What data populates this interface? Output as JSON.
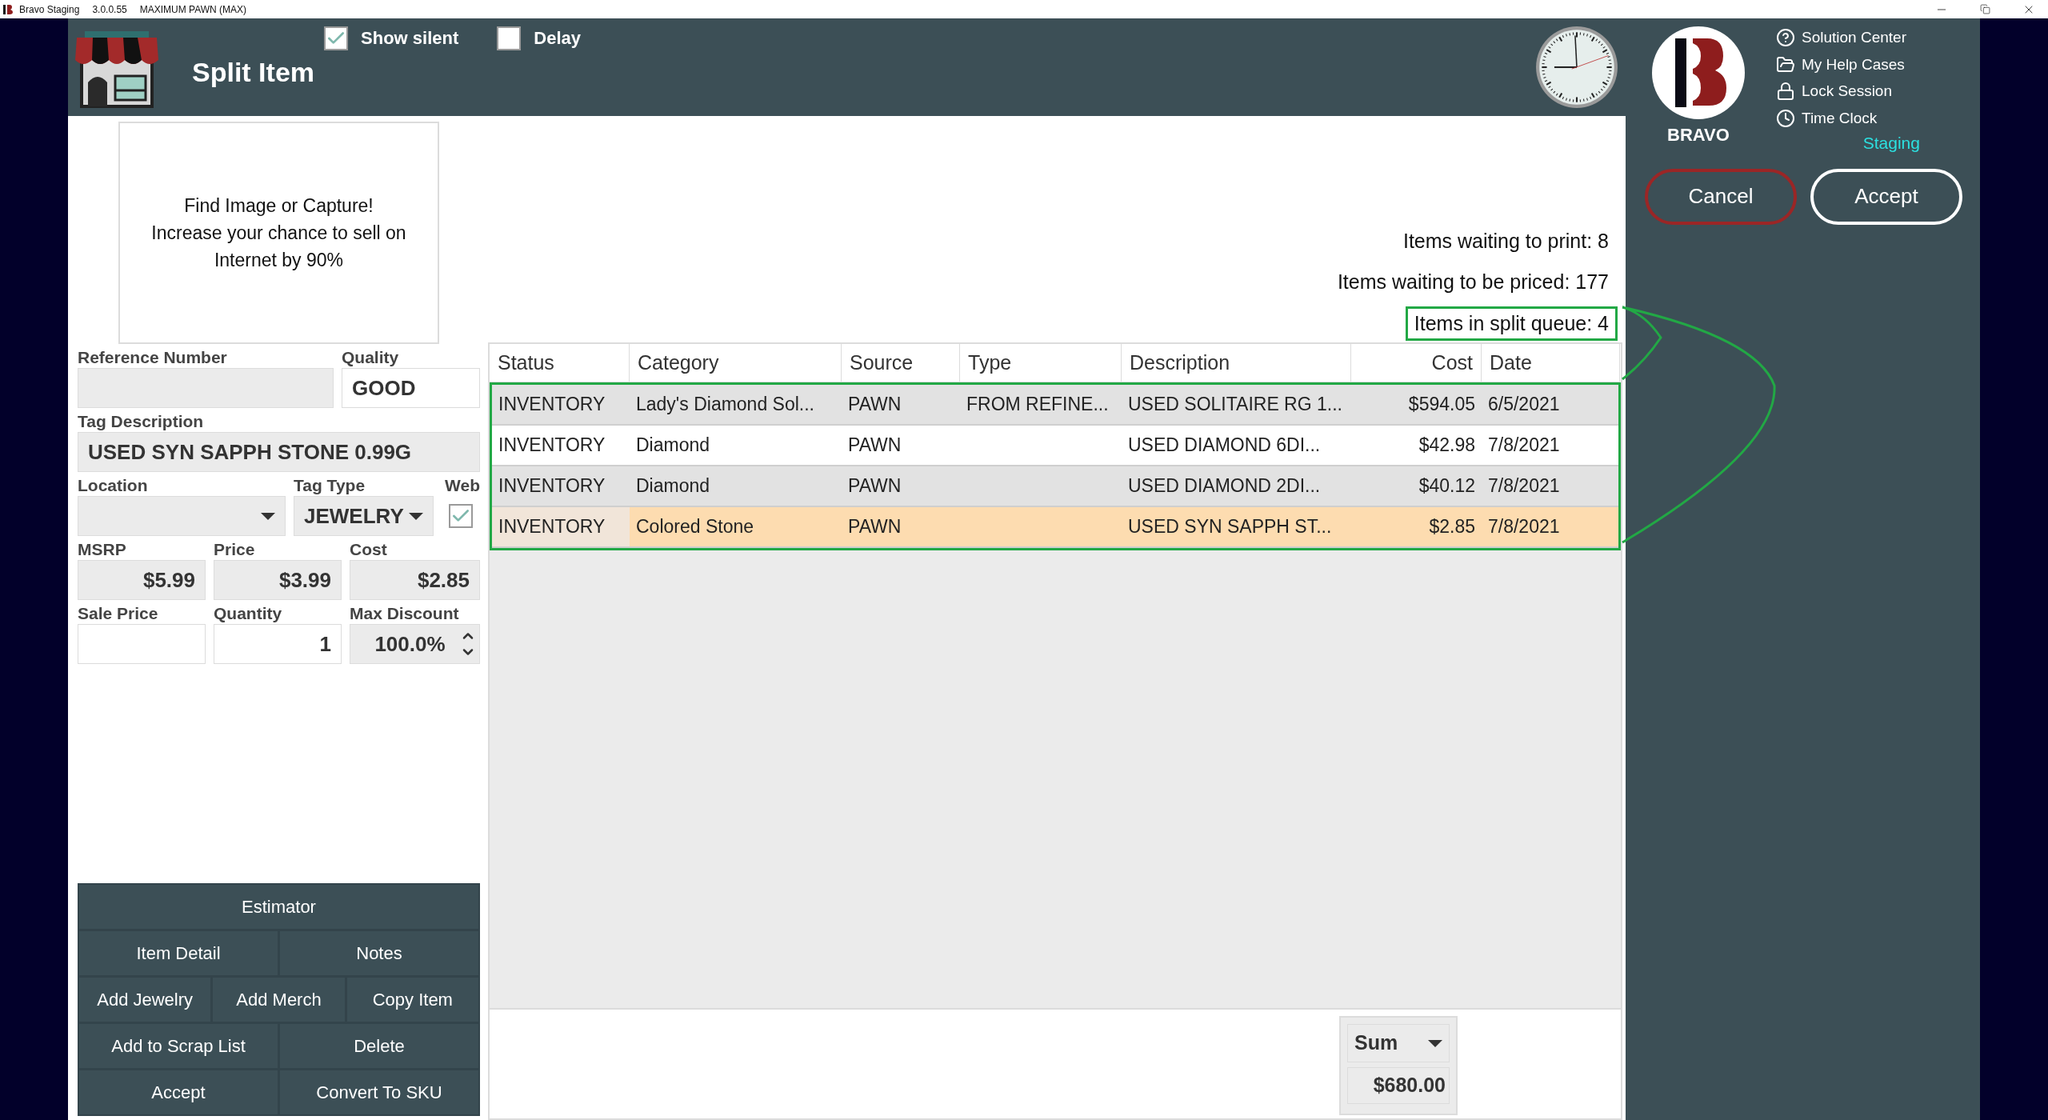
{
  "title_bar": {
    "app": "Bravo Staging",
    "version": "3.0.0.55",
    "company": "MAXIMUM PAWN (MAX)"
  },
  "header": {
    "title": "Split Item",
    "toggles": [
      {
        "label": "Show silent",
        "checked": true
      },
      {
        "label": "Delay",
        "checked": false
      }
    ]
  },
  "brand": {
    "logo_text": "BRAVO",
    "environment": "Staging"
  },
  "help_links": [
    {
      "label": "Solution Center",
      "kind": "help"
    },
    {
      "label": "My Help Cases",
      "kind": "folder"
    },
    {
      "label": "Lock Session",
      "kind": "lock"
    },
    {
      "label": "Time Clock",
      "kind": "clock"
    }
  ],
  "actions": [
    {
      "label": "Cancel",
      "kind": "cancel"
    },
    {
      "label": "Accept",
      "kind": "accept"
    }
  ],
  "form": {
    "image_prompt": [
      "Find Image or Capture!",
      "Increase your chance to sell on Internet by 90%"
    ],
    "rows": [
      [
        {
          "label": "Reference Number",
          "kind": "text",
          "readonly": true
        },
        {
          "label": "Quality",
          "kind": "text",
          "value": "GOOD",
          "readonly": false
        }
      ],
      [
        {
          "label": "Tag Description",
          "kind": "text",
          "value": "USED SYN SAPPH STONE 0.99G",
          "readonly": true
        }
      ],
      [
        {
          "label": "Location",
          "kind": "dropdown",
          "readonly": true
        },
        {
          "label": "Tag Type",
          "kind": "dropdown",
          "value": "JEWELRY",
          "readonly": true
        },
        {
          "label": "Web",
          "kind": "check",
          "checked": true
        }
      ],
      [
        {
          "label": "MSRP",
          "kind": "number",
          "value": "$5.99",
          "readonly": true
        },
        {
          "label": "Price",
          "kind": "number",
          "value": "$3.99",
          "readonly": true
        },
        {
          "label": "Cost",
          "kind": "number",
          "value": "$2.85",
          "readonly": true
        }
      ],
      [
        {
          "label": "Sale Price",
          "kind": "number",
          "readonly": false
        },
        {
          "label": "Quantity",
          "kind": "number",
          "value": "1",
          "readonly": false
        },
        {
          "label": "Max Discount",
          "kind": "spinner",
          "value": "100.0%",
          "readonly": true
        }
      ]
    ],
    "buttons": [
      [
        "Estimator"
      ],
      [
        "Item Detail",
        "Notes"
      ],
      [
        "Add Jewelry",
        "Add Merch",
        "Copy Item"
      ],
      [
        "Add to Scrap List",
        "Delete"
      ],
      [
        "Accept",
        "Convert To SKU"
      ]
    ]
  },
  "counters": [
    {
      "text": "Items waiting to print: 8",
      "highlighted": false
    },
    {
      "text": "Items waiting to be priced: 177",
      "highlighted": false
    },
    {
      "text": "Items in split queue: 4",
      "highlighted": true
    }
  ],
  "table": {
    "highlighted": true,
    "columns": [
      {
        "label": "Status",
        "numeric": false
      },
      {
        "label": "Category",
        "numeric": false
      },
      {
        "label": "Source",
        "numeric": false
      },
      {
        "label": "Type",
        "numeric": false
      },
      {
        "label": "Description",
        "numeric": false
      },
      {
        "label": "Cost",
        "numeric": true
      },
      {
        "label": "Date",
        "numeric": false
      }
    ],
    "rows": [
      {
        "cells": [
          "INVENTORY",
          "Lady's Diamond Sol...",
          "PAWN",
          "FROM REFINE...",
          "USED SOLITAIRE RG 1...",
          "$594.05",
          "6/5/2021"
        ],
        "selected": false
      },
      {
        "cells": [
          "INVENTORY",
          "Diamond",
          "PAWN",
          "",
          "USED DIAMOND 6DI...",
          "$42.98",
          "7/8/2021"
        ],
        "selected": false
      },
      {
        "cells": [
          "INVENTORY",
          "Diamond",
          "PAWN",
          "",
          "USED DIAMOND 2DI...",
          "$40.12",
          "7/8/2021"
        ],
        "selected": false
      },
      {
        "cells": [
          "INVENTORY",
          "Colored Stone",
          "PAWN",
          "",
          "USED SYN SAPPH ST...",
          "$2.85",
          "7/8/2021"
        ],
        "selected": true
      }
    ]
  },
  "summary": {
    "function": "Sum",
    "value": "$680.00"
  }
}
